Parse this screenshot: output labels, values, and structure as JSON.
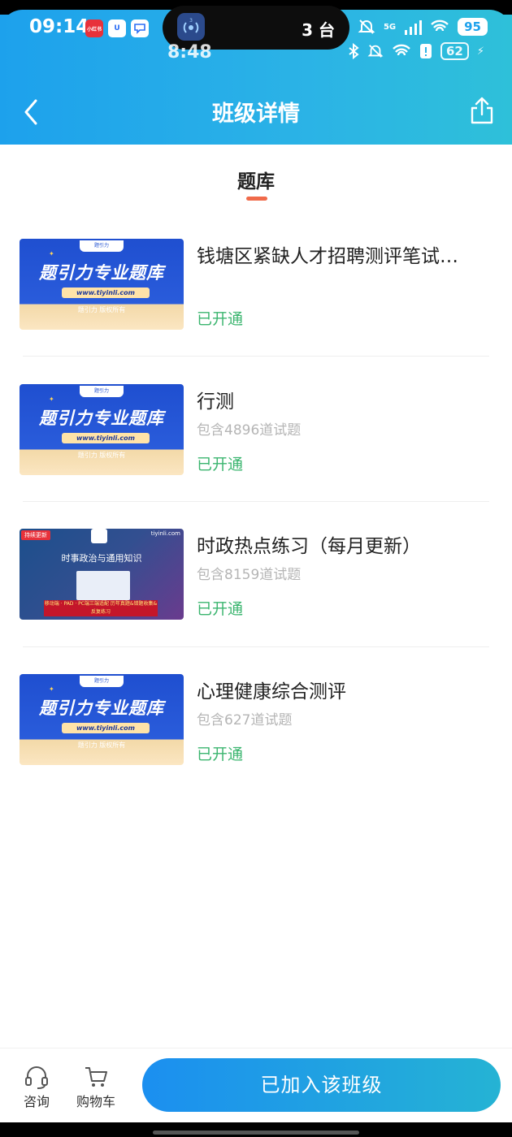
{
  "status_bar": {
    "time": "09:14",
    "mini_app_1": "小红书",
    "island_count": "3 台",
    "network": "5G",
    "battery": "95"
  },
  "ghost_status": {
    "time": "8:48",
    "battery": "62"
  },
  "nav": {
    "title": "班级详情"
  },
  "section": {
    "title": "题库"
  },
  "items": [
    {
      "title": "钱塘区紧缺人才招聘测评笔试…",
      "count": "",
      "status": "已开通",
      "thumb": {
        "big": "题引力专业题库",
        "url": "www.tiyinli.com",
        "copy": "题引力 版权所有",
        "logo": "题引力"
      }
    },
    {
      "title": "行测",
      "count": "包含4896道试题",
      "status": "已开通",
      "thumb": {
        "big": "题引力专业题库",
        "url": "www.tiyinli.com",
        "copy": "题引力 版权所有",
        "logo": "题引力"
      }
    },
    {
      "title": "时政热点练习（每月更新）",
      "count": "包含8159道试题",
      "status": "已开通",
      "thumb_alt": {
        "tag": "持续更新",
        "brand": "tiyinli.com",
        "sub": "时事政治与通用知识",
        "banner": "移动端 · PAD · PC端三端适配 历年真题&错题收集&反复练习"
      }
    },
    {
      "title": "心理健康综合测评",
      "count": "包含627道试题",
      "status": "已开通",
      "thumb": {
        "big": "题引力专业题库",
        "url": "www.tiyinli.com",
        "copy": "题引力 版权所有",
        "logo": "题引力"
      }
    }
  ],
  "bottom_bar": {
    "consult_label": "咨询",
    "cart_label": "购物车",
    "cta_label": "已加入该班级"
  },
  "colors": {
    "header_start": "#1da1ec",
    "header_end": "#2ec0d9",
    "status_green": "#3bb56f",
    "tab_underline": "#f06a4a",
    "cta_start": "#1b8ff0",
    "cta_end": "#25b3d4"
  }
}
